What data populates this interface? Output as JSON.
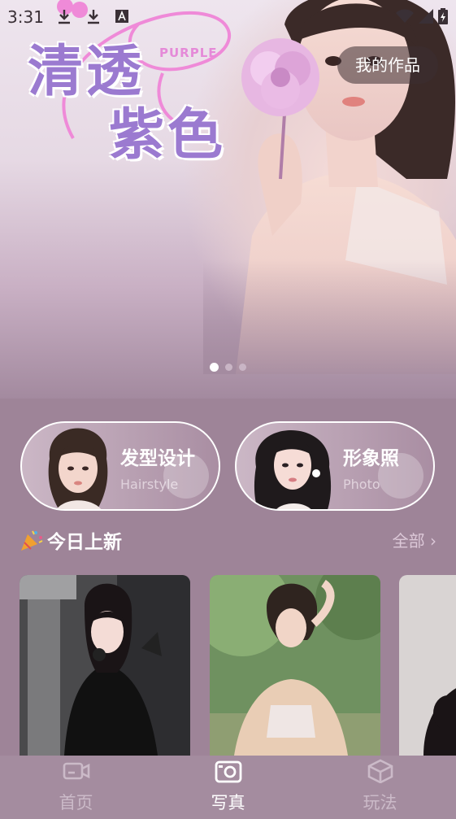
{
  "status_bar": {
    "time": "3:31",
    "icons": [
      "download-icon",
      "download-icon",
      "text-a-icon"
    ],
    "right_icons": [
      "wifi-icon",
      "signal-icon",
      "battery-charging-icon"
    ]
  },
  "hero": {
    "title_line1": "清透",
    "title_line2": "紫色",
    "tag": "PURPLE",
    "my_works_label": "我的作品",
    "slides": 3,
    "active_slide": 1
  },
  "features": [
    {
      "title": "发型设计",
      "subtitle": "Hairstyle"
    },
    {
      "title": "形象照",
      "subtitle": "Photo"
    }
  ],
  "section": {
    "title": "今日上新",
    "see_all": "全部 ›"
  },
  "nav": [
    {
      "label": "首页",
      "icon": "video-camera-icon",
      "active": false
    },
    {
      "label": "写真",
      "icon": "camera-icon",
      "active": true
    },
    {
      "label": "玩法",
      "icon": "cube-icon",
      "active": false
    }
  ],
  "colors": {
    "background": "#9e8498",
    "accent_purple": "#9b7ad0",
    "nav_bg": "#a48c9f"
  }
}
